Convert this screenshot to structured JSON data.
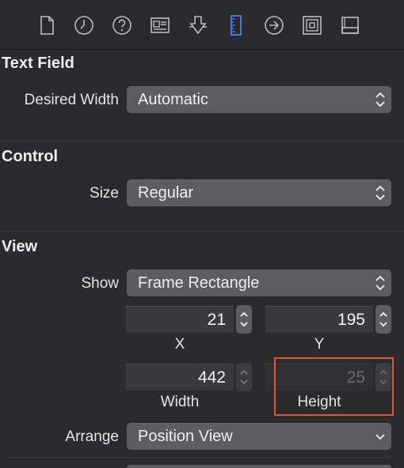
{
  "tabs": [
    {
      "name": "file-inspector-icon"
    },
    {
      "name": "history-inspector-icon"
    },
    {
      "name": "quick-help-icon"
    },
    {
      "name": "identity-inspector-icon"
    },
    {
      "name": "attributes-inspector-icon"
    },
    {
      "name": "size-inspector-icon",
      "selected": true
    },
    {
      "name": "connections-inspector-icon"
    },
    {
      "name": "bindings-inspector-icon"
    },
    {
      "name": "view-effects-inspector-icon"
    }
  ],
  "text_field": {
    "title": "Text Field",
    "desired_width_label": "Desired Width",
    "desired_width_value": "Automatic"
  },
  "control": {
    "title": "Control",
    "size_label": "Size",
    "size_value": "Regular"
  },
  "view": {
    "title": "View",
    "show_label": "Show",
    "show_value": "Frame Rectangle",
    "x_value": "21",
    "x_caption": "X",
    "y_value": "195",
    "y_caption": "Y",
    "width_value": "442",
    "width_caption": "Width",
    "height_value": "25",
    "height_caption": "Height",
    "arrange_label": "Arrange",
    "arrange_value": "Position View"
  },
  "colors": {
    "background": "#2b2b2d",
    "accent": "#3d7be0",
    "highlight": "#e2553c"
  }
}
